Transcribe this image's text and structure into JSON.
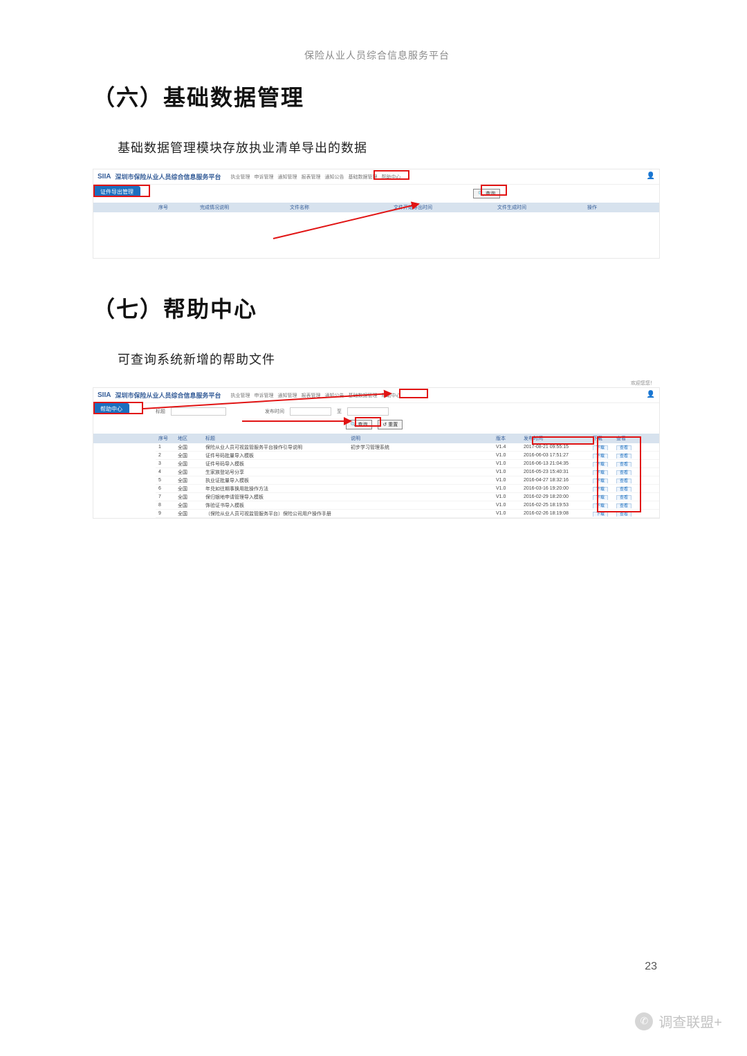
{
  "doc": {
    "top_title": "保险从业人员综合信息服务平台",
    "page_number": "23",
    "footer_brand": "调查联盟+"
  },
  "section6": {
    "heading": "（六）基础数据管理",
    "body": "基础数据管理模块存放执业清单导出的数据"
  },
  "section7": {
    "heading": "（七）帮助中心",
    "body": "可查询系统新增的帮助文件"
  },
  "app": {
    "logo": "SIIA",
    "title": "深圳市保险从业人员综合信息服务平台",
    "menu": [
      "执业管理",
      "申诉管理",
      "通知管理",
      "报表管理",
      "通知公告",
      "基础数据管理",
      "帮助中心"
    ]
  },
  "shot1": {
    "side_label": "证件导出管理",
    "search_btn": "查询",
    "grid_cols": [
      "序号",
      "完成情况说明",
      "文件名称",
      "文件开始导出时间",
      "文件生成时间",
      "操作"
    ]
  },
  "shot2": {
    "welcome": "欢迎您您！",
    "side_label": "帮助中心",
    "filter": {
      "l1": "标题",
      "l2": "发布时间",
      "sep": "至",
      "btn_search": "查询",
      "btn_reset": "重置"
    },
    "grid_cols": [
      "序号",
      "地区",
      "标题",
      "说明",
      "版本",
      "发布时间",
      "下载",
      "查看"
    ],
    "op_download": "下载",
    "op_view": "查看",
    "rows": [
      {
        "idx": "1",
        "region": "全国",
        "title": "保险从业人员可视监管服务平台操作引导说明",
        "desc": "初步学习管理系统",
        "ver": "V1.4",
        "time": "2017-08-21 09:55:15"
      },
      {
        "idx": "2",
        "region": "全国",
        "title": "证件号码批量导入模板",
        "desc": "",
        "ver": "V1.0",
        "time": "2016-06-03 17:51:27"
      },
      {
        "idx": "3",
        "region": "全国",
        "title": "证件号码导入模板",
        "desc": "",
        "ver": "V1.0",
        "time": "2016-06-13 21:04:35"
      },
      {
        "idx": "4",
        "region": "全国",
        "title": "生家族登站号分享",
        "desc": "",
        "ver": "V1.0",
        "time": "2016-05-23 15:40:31"
      },
      {
        "idx": "5",
        "region": "全国",
        "title": "执业证批量导入模板",
        "desc": "",
        "ver": "V1.0",
        "time": "2016-04-27 18:32:16"
      },
      {
        "idx": "6",
        "region": "全国",
        "title": "年兑如往期事换用批操作方法",
        "desc": "",
        "ver": "V1.0",
        "time": "2016-03-16 19:20:00"
      },
      {
        "idx": "7",
        "region": "全国",
        "title": "保归银地申请管理导入模板",
        "desc": "",
        "ver": "V1.0",
        "time": "2016-02-29 18:20:00"
      },
      {
        "idx": "8",
        "region": "全国",
        "title": "饰验证书导入模板",
        "desc": "",
        "ver": "V1.0",
        "time": "2016-02-25 18:19:53"
      },
      {
        "idx": "9",
        "region": "全国",
        "title": "（保险从业人员可视监管服务平台）保险公司用户操作手册",
        "desc": "",
        "ver": "V1.0",
        "time": "2016-02-26 18:19:08"
      }
    ]
  }
}
